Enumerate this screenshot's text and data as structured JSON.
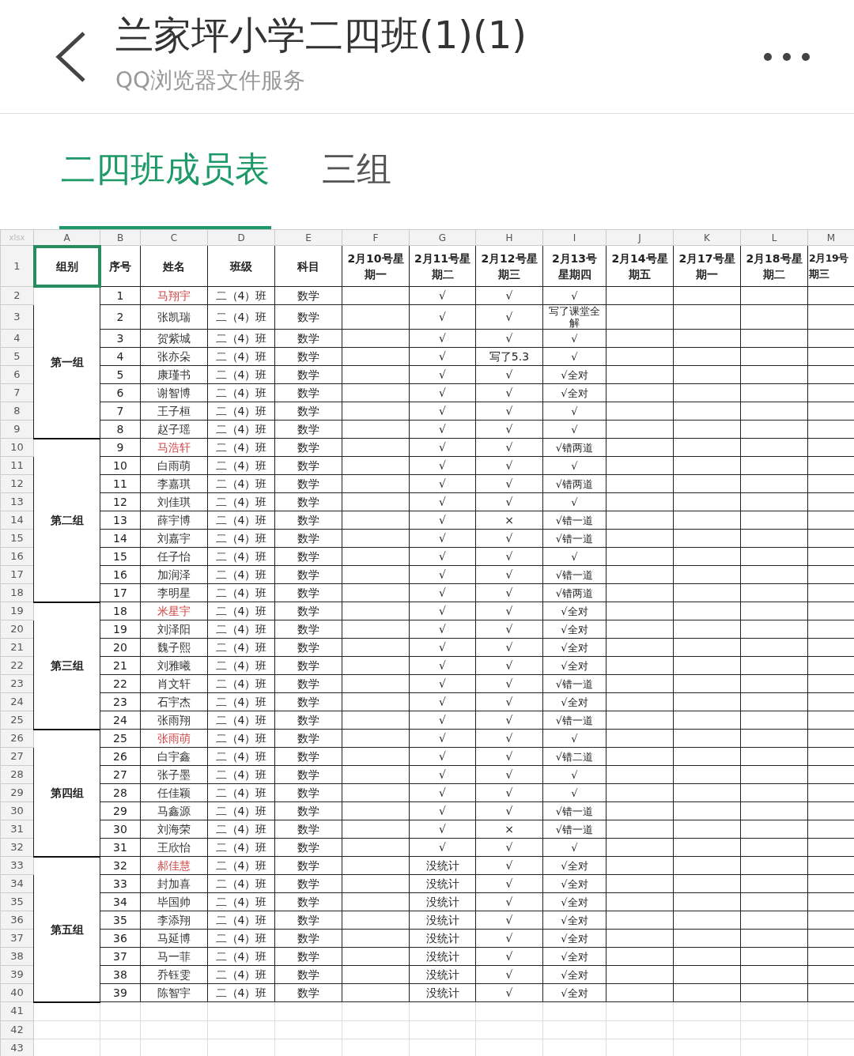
{
  "top_bar": {
    "title": "兰家坪小学二四班(1)(1)",
    "subtitle": "QQ浏览器文件服务"
  },
  "tabs": [
    {
      "label": "二四班成员表",
      "selected": true
    },
    {
      "label": "三组",
      "selected": false
    }
  ],
  "sheet": {
    "corner": "xlsx",
    "column_letters": [
      "A",
      "B",
      "C",
      "D",
      "E",
      "F",
      "G",
      "H",
      "I",
      "J",
      "K",
      "L",
      "M"
    ],
    "row_numbers": [
      "1",
      "2",
      "3",
      "4",
      "5",
      "6",
      "7",
      "8",
      "9",
      "10",
      "11",
      "12",
      "13",
      "14",
      "15",
      "16",
      "17",
      "18",
      "19",
      "20",
      "21",
      "22",
      "23",
      "24",
      "25",
      "26",
      "27",
      "28",
      "29",
      "30",
      "31",
      "32",
      "33",
      "34",
      "35",
      "36",
      "37",
      "38",
      "39",
      "40",
      "41",
      "42",
      "43"
    ],
    "header_cells": [
      {
        "lines": [
          "组别"
        ],
        "selected": true
      },
      {
        "lines": [
          "序号"
        ],
        "selected": false
      },
      {
        "lines": [
          "姓名"
        ],
        "selected": false
      },
      {
        "lines": [
          "班级"
        ],
        "selected": false
      },
      {
        "lines": [
          "科目"
        ],
        "selected": false
      },
      {
        "lines": [
          "2月10号星",
          "期一"
        ],
        "selected": false
      },
      {
        "lines": [
          "2月11号星",
          "期二"
        ],
        "selected": false
      },
      {
        "lines": [
          "2月12号星",
          "期三"
        ],
        "selected": false
      },
      {
        "lines": [
          "2月13号",
          "星期四"
        ],
        "selected": false
      },
      {
        "lines": [
          "2月14号星",
          "期五"
        ],
        "selected": false
      },
      {
        "lines": [
          "2月17号星",
          "期一"
        ],
        "selected": false
      },
      {
        "lines": [
          "2月18号星",
          "期二"
        ],
        "selected": false
      },
      {
        "lines": [
          "2月19号",
          "期三"
        ],
        "selected": false
      }
    ],
    "groups": [
      {
        "name": "第一组",
        "students": [
          {
            "no": "1",
            "name": "马翔宇",
            "highlighted": true,
            "class": "二（4）班",
            "subject": "数学",
            "feb11": "√",
            "feb12": "√",
            "feb13": "√"
          },
          {
            "no": "2",
            "name": "张凯瑞",
            "highlighted": false,
            "class": "二（4）班",
            "subject": "数学",
            "feb11": "√",
            "feb12": "√",
            "feb13": "写了课堂全解"
          },
          {
            "no": "3",
            "name": "贺紫城",
            "highlighted": false,
            "class": "二（4）班",
            "subject": "数学",
            "feb11": "√",
            "feb12": "√",
            "feb13": "√"
          },
          {
            "no": "4",
            "name": "张亦朵",
            "highlighted": false,
            "class": "二（4）班",
            "subject": "数学",
            "feb11": "√",
            "feb12": "写了5.3",
            "feb13": "√"
          },
          {
            "no": "5",
            "name": "康瑾书",
            "highlighted": false,
            "class": "二（4）班",
            "subject": "数学",
            "feb11": "√",
            "feb12": "√",
            "feb13": "√全对"
          },
          {
            "no": "6",
            "name": "谢智博",
            "highlighted": false,
            "class": "二（4）班",
            "subject": "数学",
            "feb11": "√",
            "feb12": "√",
            "feb13": "√全对"
          },
          {
            "no": "7",
            "name": "王子桓",
            "highlighted": false,
            "class": "二（4）班",
            "subject": "数学",
            "feb11": "√",
            "feb12": "√",
            "feb13": "√"
          },
          {
            "no": "8",
            "name": "赵子瑶",
            "highlighted": false,
            "class": "二（4）班",
            "subject": "数学",
            "feb11": "√",
            "feb12": "√",
            "feb13": "√"
          }
        ]
      },
      {
        "name": "第二组",
        "students": [
          {
            "no": "9",
            "name": "马浩轩",
            "highlighted": true,
            "class": "二（4）班",
            "subject": "数学",
            "feb11": "√",
            "feb12": "√",
            "feb13": "√错两道"
          },
          {
            "no": "10",
            "name": "白雨萌",
            "highlighted": false,
            "class": "二（4）班",
            "subject": "数学",
            "feb11": "√",
            "feb12": "√",
            "feb13": "√"
          },
          {
            "no": "11",
            "name": "李嘉琪",
            "highlighted": false,
            "class": "二（4）班",
            "subject": "数学",
            "feb11": "√",
            "feb12": "√",
            "feb13": "√错两道"
          },
          {
            "no": "12",
            "name": "刘佳琪",
            "highlighted": false,
            "class": "二（4）班",
            "subject": "数学",
            "feb11": "√",
            "feb12": "√",
            "feb13": "√"
          },
          {
            "no": "13",
            "name": "薛宇博",
            "highlighted": false,
            "class": "二（4）班",
            "subject": "数学",
            "feb11": "√",
            "feb12": "×",
            "feb13": "√错一道"
          },
          {
            "no": "14",
            "name": "刘嘉宇",
            "highlighted": false,
            "class": "二（4）班",
            "subject": "数学",
            "feb11": "√",
            "feb12": "√",
            "feb13": "√错一道"
          },
          {
            "no": "15",
            "name": "任子怡",
            "highlighted": false,
            "class": "二（4）班",
            "subject": "数学",
            "feb11": "√",
            "feb12": "√",
            "feb13": "√"
          },
          {
            "no": "16",
            "name": "加润泽",
            "highlighted": false,
            "class": "二（4）班",
            "subject": "数学",
            "feb11": "√",
            "feb12": "√",
            "feb13": "√错一道"
          },
          {
            "no": "17",
            "name": "李明星",
            "highlighted": false,
            "class": "二（4）班",
            "subject": "数学",
            "feb11": "√",
            "feb12": "√",
            "feb13": "√错两道"
          }
        ]
      },
      {
        "name": "第三组",
        "students": [
          {
            "no": "18",
            "name": "米星宇",
            "highlighted": true,
            "class": "二（4）班",
            "subject": "数学",
            "feb11": "√",
            "feb12": "√",
            "feb13": "√全对"
          },
          {
            "no": "19",
            "name": "刘泽阳",
            "highlighted": false,
            "class": "二（4）班",
            "subject": "数学",
            "feb11": "√",
            "feb12": "√",
            "feb13": "√全对"
          },
          {
            "no": "20",
            "name": "魏子熙",
            "highlighted": false,
            "class": "二（4）班",
            "subject": "数学",
            "feb11": "√",
            "feb12": "√",
            "feb13": "√全对"
          },
          {
            "no": "21",
            "name": "刘雅曦",
            "highlighted": false,
            "class": "二（4）班",
            "subject": "数学",
            "feb11": "√",
            "feb12": "√",
            "feb13": "√全对"
          },
          {
            "no": "22",
            "name": "肖文轩",
            "highlighted": false,
            "class": "二（4）班",
            "subject": "数学",
            "feb11": "√",
            "feb12": "√",
            "feb13": "√错一道"
          },
          {
            "no": "23",
            "name": "石宇杰",
            "highlighted": false,
            "class": "二（4）班",
            "subject": "数学",
            "feb11": "√",
            "feb12": "√",
            "feb13": "√全对"
          },
          {
            "no": "24",
            "name": "张雨翔",
            "highlighted": false,
            "class": "二（4）班",
            "subject": "数学",
            "feb11": "√",
            "feb12": "√",
            "feb13": "√错一道"
          }
        ]
      },
      {
        "name": "第四组",
        "students": [
          {
            "no": "25",
            "name": "张雨萌",
            "highlighted": true,
            "class": "二（4）班",
            "subject": "数学",
            "feb11": "√",
            "feb12": "√",
            "feb13": "√"
          },
          {
            "no": "26",
            "name": "白宇鑫",
            "highlighted": false,
            "class": "二（4）班",
            "subject": "数学",
            "feb11": "√",
            "feb12": "√",
            "feb13": "√错二道"
          },
          {
            "no": "27",
            "name": "张子墨",
            "highlighted": false,
            "class": "二（4）班",
            "subject": "数学",
            "feb11": "√",
            "feb12": "√",
            "feb13": "√"
          },
          {
            "no": "28",
            "name": "任佳颖",
            "highlighted": false,
            "class": "二（4）班",
            "subject": "数学",
            "feb11": "√",
            "feb12": "√",
            "feb13": "√"
          },
          {
            "no": "29",
            "name": "马鑫源",
            "highlighted": false,
            "class": "二（4）班",
            "subject": "数学",
            "feb11": "√",
            "feb12": "√",
            "feb13": "√错一道"
          },
          {
            "no": "30",
            "name": "刘海荣",
            "highlighted": false,
            "class": "二（4）班",
            "subject": "数学",
            "feb11": "√",
            "feb12": "×",
            "feb13": "√错一道"
          },
          {
            "no": "31",
            "name": "王欣怡",
            "highlighted": false,
            "class": "二（4）班",
            "subject": "数学",
            "feb11": "√",
            "feb12": "√",
            "feb13": "√"
          }
        ]
      },
      {
        "name": "第五组",
        "students": [
          {
            "no": "32",
            "name": "郝佳慧",
            "highlighted": true,
            "class": "二（4）班",
            "subject": "数学",
            "feb11": "没统计",
            "feb12": "√",
            "feb13": "√全对"
          },
          {
            "no": "33",
            "name": "封加喜",
            "highlighted": false,
            "class": "二（4）班",
            "subject": "数学",
            "feb11": "没统计",
            "feb12": "√",
            "feb13": "√全对"
          },
          {
            "no": "34",
            "name": "毕国帅",
            "highlighted": false,
            "class": "二（4）班",
            "subject": "数学",
            "feb11": "没统计",
            "feb12": "√",
            "feb13": "√全对"
          },
          {
            "no": "35",
            "name": "李添翔",
            "highlighted": false,
            "class": "二（4）班",
            "subject": "数学",
            "feb11": "没统计",
            "feb12": "√",
            "feb13": "√全对"
          },
          {
            "no": "36",
            "name": "马延博",
            "highlighted": false,
            "class": "二（4）班",
            "subject": "数学",
            "feb11": "没统计",
            "feb12": "√",
            "feb13": "√全对"
          },
          {
            "no": "37",
            "name": "马一菲",
            "highlighted": false,
            "class": "二（4）班",
            "subject": "数学",
            "feb11": "没统计",
            "feb12": "√",
            "feb13": "√全对"
          },
          {
            "no": "38",
            "name": "乔钰雯",
            "highlighted": false,
            "class": "二（4）班",
            "subject": "数学",
            "feb11": "没统计",
            "feb12": "√",
            "feb13": "√全对"
          },
          {
            "no": "39",
            "name": "陈智宇",
            "highlighted": false,
            "class": "二（4）班",
            "subject": "数学",
            "feb11": "没统计",
            "feb12": "√",
            "feb13": "√全对"
          }
        ]
      }
    ]
  }
}
